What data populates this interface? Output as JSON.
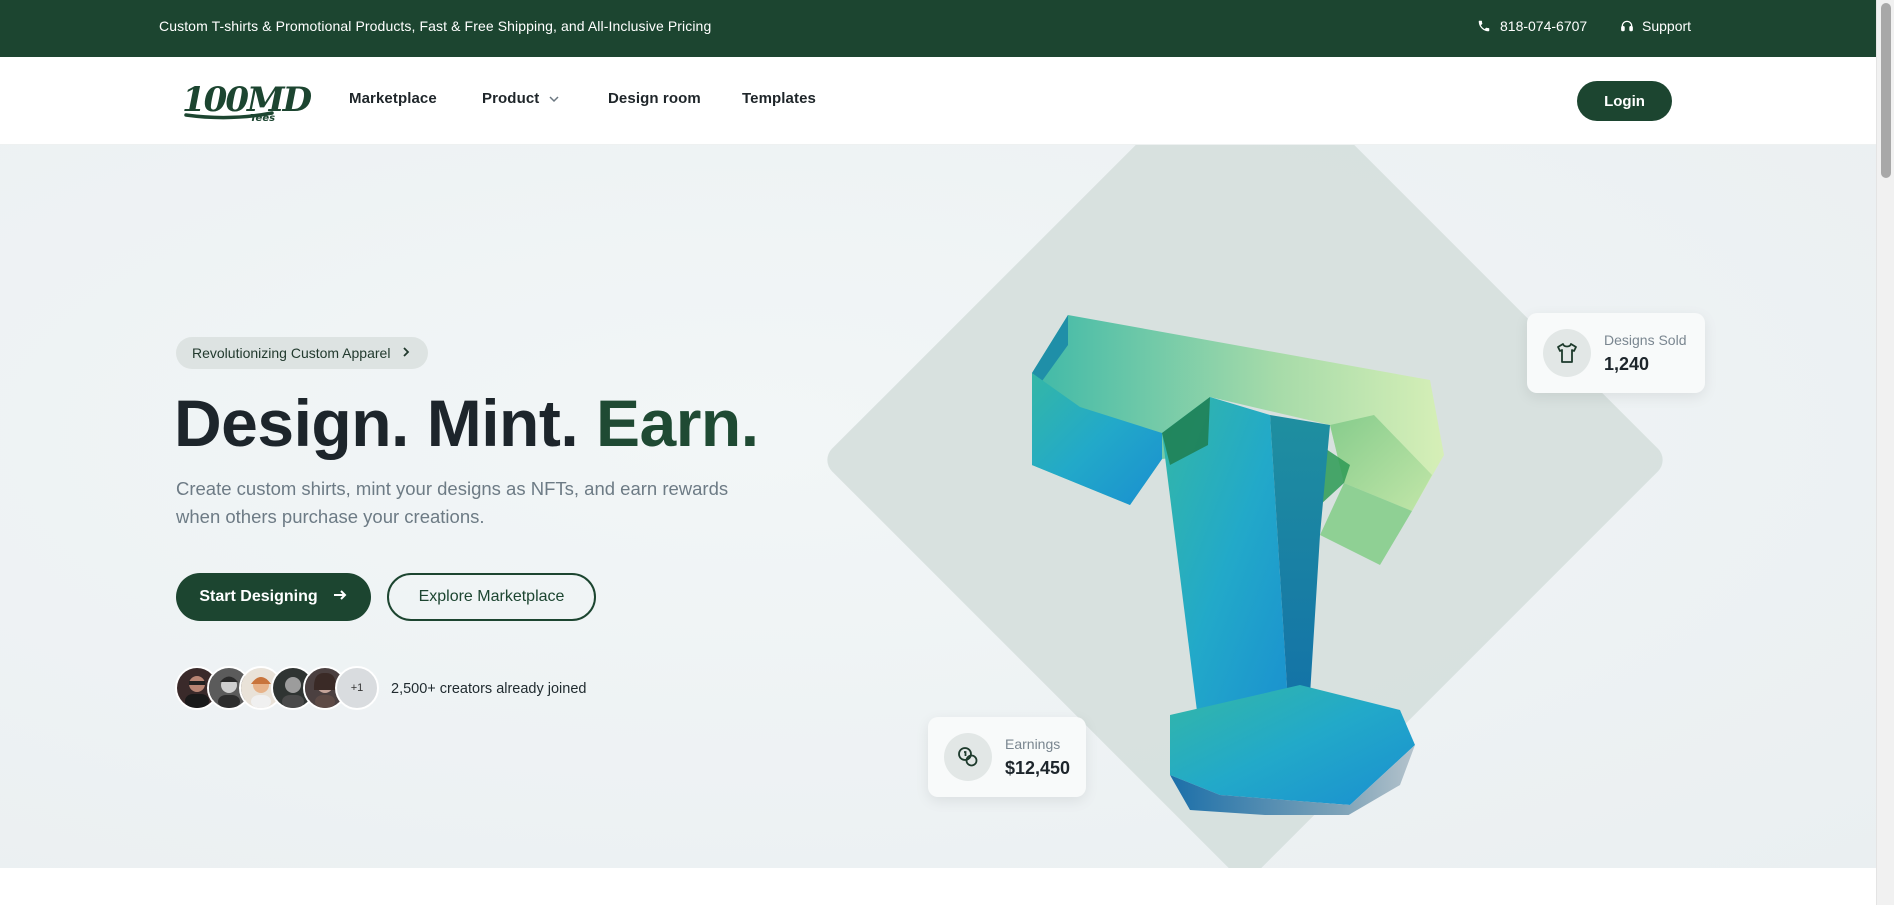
{
  "topbar": {
    "message": "Custom T-shirts & Promotional Products, Fast & Free Shipping, and All-Inclusive Pricing",
    "phone": "818-074-6707",
    "support": "Support"
  },
  "nav": {
    "logo_text": "100MD",
    "logo_subtext": "Tees",
    "links": [
      "Marketplace",
      "Product",
      "Design room",
      "Templates"
    ],
    "login": "Login"
  },
  "hero": {
    "pill": "Revolutionizing Custom Apparel",
    "headline_main": "Design. Mint. ",
    "headline_accent": "Earn.",
    "subtitle": "Create custom shirts, mint your designs as NFTs, and earn rewards when others purchase your creations.",
    "primary_button": "Start Designing",
    "secondary_button": "Explore Marketplace",
    "avatars_more": "+1",
    "joined_text": "2,500+ creators already joined"
  },
  "stats": {
    "sold_label": "Designs Sold",
    "sold_value": "1,240",
    "earnings_label": "Earnings",
    "earnings_value": "$12,450"
  },
  "colors": {
    "brand": "#1c4530",
    "accent_text": "#1f4a33"
  }
}
